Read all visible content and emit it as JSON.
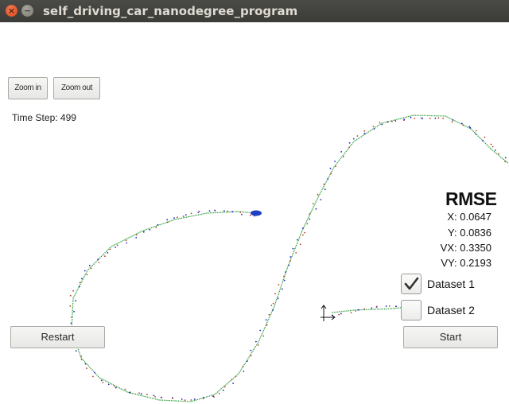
{
  "window": {
    "title": "self_driving_car_nanodegree_program",
    "close_glyph": "×",
    "minimize_glyph": "−"
  },
  "toolbar": {
    "zoom_in_label": "Zoom in",
    "zoom_out_label": "Zoom out"
  },
  "status": {
    "time_step": "Time Step: 499"
  },
  "rmse": {
    "title": "RMSE",
    "x": "X: 0.0647",
    "y": "Y: 0.0836",
    "vx": "VX: 0.3350",
    "vy": "VY: 0.2193"
  },
  "datasets": [
    {
      "label": "Dataset 1",
      "checked": true
    },
    {
      "label": "Dataset 2",
      "checked": false
    }
  ],
  "controls": {
    "restart_label": "Restart",
    "start_label": "Start"
  },
  "colors": {
    "ground_truth": "#1c9a2c",
    "lidar": "#c0392b",
    "radar": "#2020c8",
    "estimate": "#1f3fbf"
  },
  "icons": {
    "car": "car-marker-icon",
    "checkmark": "checkmark-icon"
  }
}
